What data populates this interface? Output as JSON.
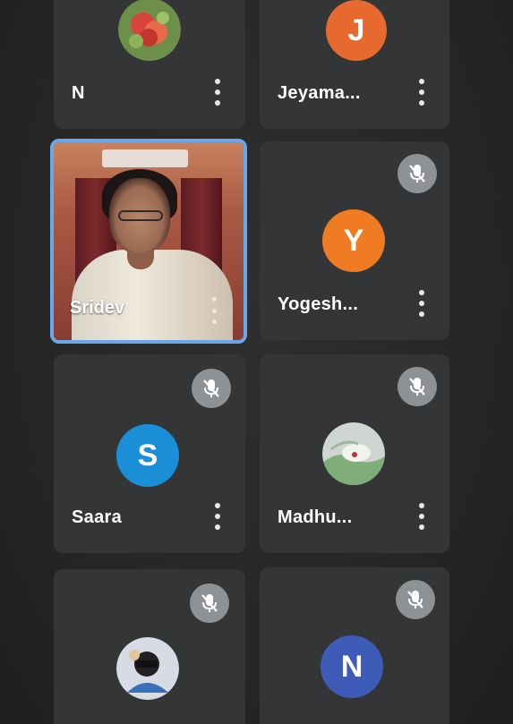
{
  "participants": [
    {
      "name": "N",
      "avatar": "flower-photo",
      "muted": false
    },
    {
      "name": "Jeyama...",
      "initial": "J",
      "color": "#e8692d",
      "muted": false
    },
    {
      "name": "Sridev",
      "avatar": "video",
      "muted": false,
      "active": true
    },
    {
      "name": "Yogesh...",
      "initial": "Y",
      "color": "#ef7c22",
      "muted": true
    },
    {
      "name": "Saara",
      "initial": "S",
      "color": "#1a8fd8",
      "muted": true
    },
    {
      "name": "Madhu...",
      "avatar": "landscape-photo",
      "muted": true
    },
    {
      "name": "",
      "avatar": "person-photo",
      "muted": true
    },
    {
      "name": "",
      "initial": "N",
      "color": "#3e5bb8",
      "muted": true
    }
  ],
  "colors": {
    "tile": "#333536",
    "active_border": "#6aa6e8",
    "mute_badge": "#8f9294"
  },
  "icons": {
    "more": "more-vert-icon",
    "mute": "mic-off-icon"
  }
}
